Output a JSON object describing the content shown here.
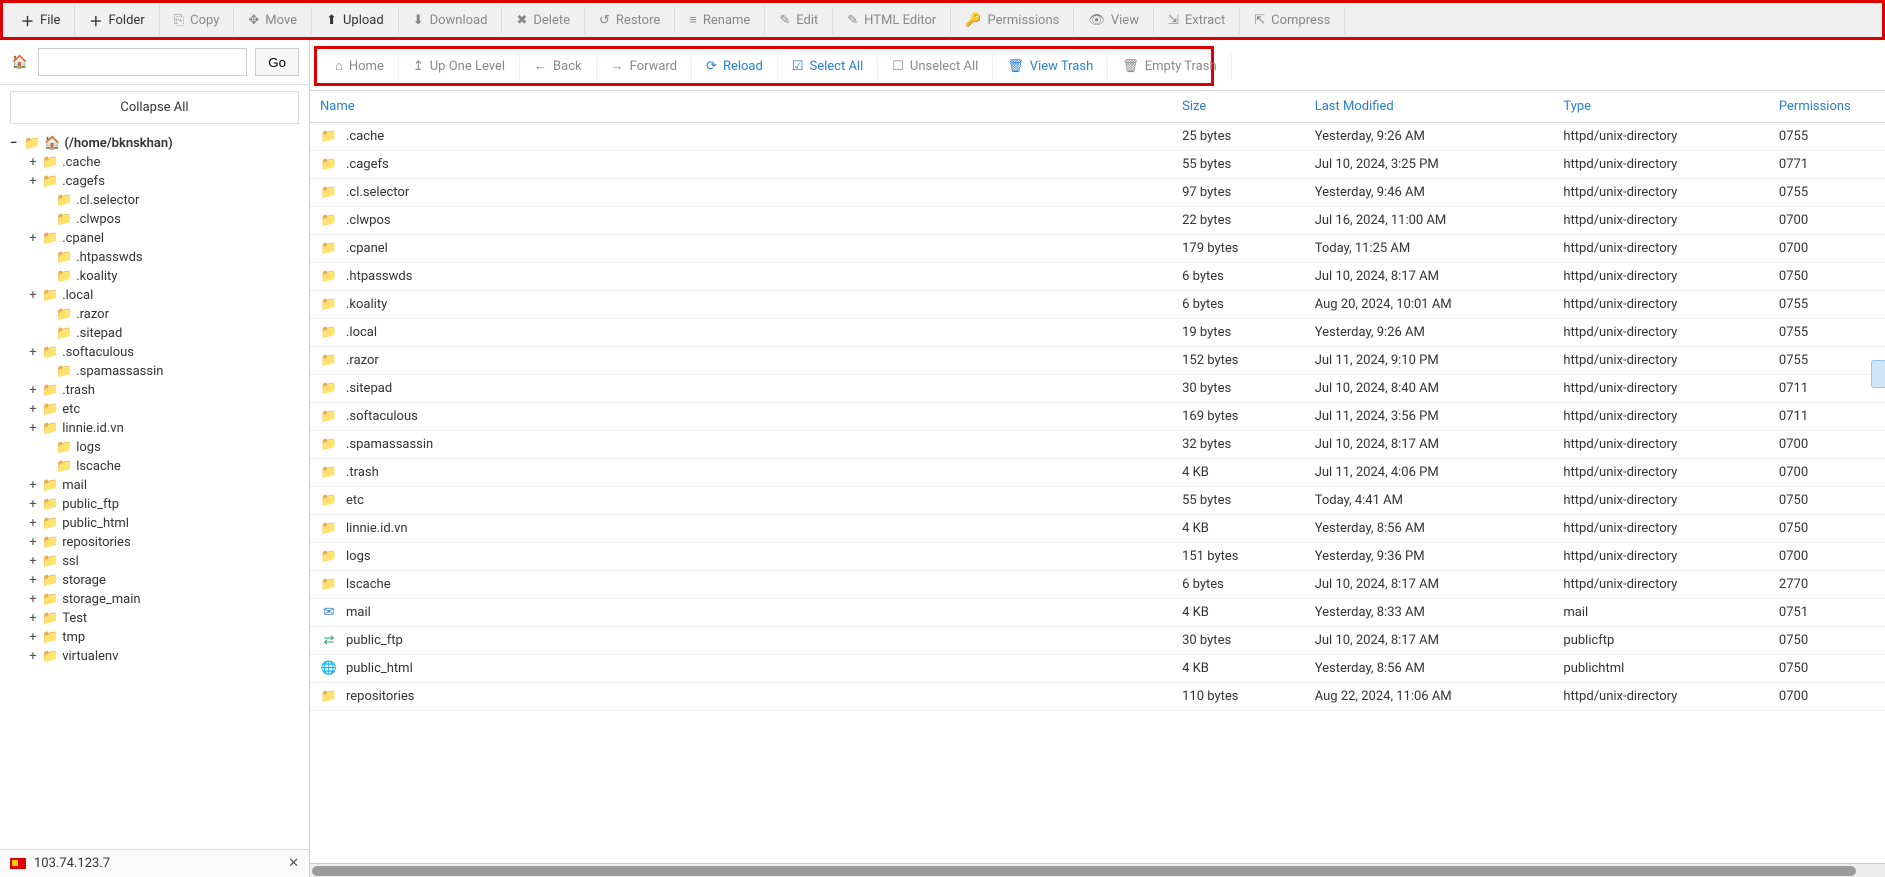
{
  "toolbarTop": [
    {
      "icon": "plus",
      "label": "File",
      "active": true
    },
    {
      "icon": "plus",
      "label": "Folder",
      "active": true
    },
    {
      "icon": "copy",
      "label": "Copy",
      "active": false
    },
    {
      "icon": "move",
      "label": "Move",
      "active": false
    },
    {
      "icon": "upload",
      "label": "Upload",
      "active": true
    },
    {
      "icon": "download",
      "label": "Download",
      "active": false
    },
    {
      "icon": "delete",
      "label": "Delete",
      "active": false
    },
    {
      "icon": "restore",
      "label": "Restore",
      "active": false
    },
    {
      "icon": "rename",
      "label": "Rename",
      "active": false
    },
    {
      "icon": "edit",
      "label": "Edit",
      "active": false
    },
    {
      "icon": "html",
      "label": "HTML Editor",
      "active": false
    },
    {
      "icon": "perm",
      "label": "Permissions",
      "active": false
    },
    {
      "icon": "view",
      "label": "View",
      "active": false
    },
    {
      "icon": "extract",
      "label": "Extract",
      "active": false
    },
    {
      "icon": "compress",
      "label": "Compress",
      "active": false
    }
  ],
  "sidebar": {
    "pathValue": "",
    "goLabel": "Go",
    "collapseLabel": "Collapse All",
    "rootLabel": "(/home/bknskhan)",
    "items": [
      {
        "name": ".cache",
        "expandable": true
      },
      {
        "name": ".cagefs",
        "expandable": true
      },
      {
        "name": ".cl.selector",
        "expandable": false,
        "indent": true
      },
      {
        "name": ".clwpos",
        "expandable": false,
        "indent": true
      },
      {
        "name": ".cpanel",
        "expandable": true
      },
      {
        "name": ".htpasswds",
        "expandable": false,
        "indent": true
      },
      {
        "name": ".koality",
        "expandable": false,
        "indent": true
      },
      {
        "name": ".local",
        "expandable": true
      },
      {
        "name": ".razor",
        "expandable": false,
        "indent": true
      },
      {
        "name": ".sitepad",
        "expandable": false,
        "indent": true
      },
      {
        "name": ".softaculous",
        "expandable": true
      },
      {
        "name": ".spamassassin",
        "expandable": false,
        "indent": true
      },
      {
        "name": ".trash",
        "expandable": true
      },
      {
        "name": "etc",
        "expandable": true
      },
      {
        "name": "linnie.id.vn",
        "expandable": true
      },
      {
        "name": "logs",
        "expandable": false,
        "indent": true
      },
      {
        "name": "lscache",
        "expandable": false,
        "indent": true
      },
      {
        "name": "mail",
        "expandable": true
      },
      {
        "name": "public_ftp",
        "expandable": true
      },
      {
        "name": "public_html",
        "expandable": true
      },
      {
        "name": "repositories",
        "expandable": true
      },
      {
        "name": "ssl",
        "expandable": true
      },
      {
        "name": "storage",
        "expandable": true
      },
      {
        "name": "storage_main",
        "expandable": true
      },
      {
        "name": "Test",
        "expandable": true
      },
      {
        "name": "tmp",
        "expandable": true
      },
      {
        "name": "virtualenv",
        "expandable": true
      }
    ],
    "footerIp": "103.74.123.7"
  },
  "toolbar2": [
    {
      "icon": "home",
      "label": "Home",
      "blue": false
    },
    {
      "icon": "up",
      "label": "Up One Level",
      "blue": false
    },
    {
      "icon": "back",
      "label": "Back",
      "blue": false
    },
    {
      "icon": "forward",
      "label": "Forward",
      "blue": false
    },
    {
      "icon": "reload",
      "label": "Reload",
      "blue": true
    },
    {
      "icon": "check",
      "label": "Select All",
      "blue": true
    },
    {
      "icon": "uncheck",
      "label": "Unselect All",
      "blue": false
    },
    {
      "icon": "trash",
      "label": "View Trash",
      "blue": true
    },
    {
      "icon": "trash",
      "label": "Empty Trash",
      "blue": false
    }
  ],
  "columns": {
    "name": "Name",
    "size": "Size",
    "modified": "Last Modified",
    "type": "Type",
    "permissions": "Permissions"
  },
  "rows": [
    {
      "icon": "folder",
      "name": ".cache",
      "size": "25 bytes",
      "modified": "Yesterday, 9:26 AM",
      "type": "httpd/unix-directory",
      "perm": "0755"
    },
    {
      "icon": "folder",
      "name": ".cagefs",
      "size": "55 bytes",
      "modified": "Jul 10, 2024, 3:25 PM",
      "type": "httpd/unix-directory",
      "perm": "0771"
    },
    {
      "icon": "folder",
      "name": ".cl.selector",
      "size": "97 bytes",
      "modified": "Yesterday, 9:46 AM",
      "type": "httpd/unix-directory",
      "perm": "0755"
    },
    {
      "icon": "folder",
      "name": ".clwpos",
      "size": "22 bytes",
      "modified": "Jul 16, 2024, 11:00 AM",
      "type": "httpd/unix-directory",
      "perm": "0700"
    },
    {
      "icon": "folder",
      "name": ".cpanel",
      "size": "179 bytes",
      "modified": "Today, 11:25 AM",
      "type": "httpd/unix-directory",
      "perm": "0700"
    },
    {
      "icon": "folder",
      "name": ".htpasswds",
      "size": "6 bytes",
      "modified": "Jul 10, 2024, 8:17 AM",
      "type": "httpd/unix-directory",
      "perm": "0750"
    },
    {
      "icon": "folder",
      "name": ".koality",
      "size": "6 bytes",
      "modified": "Aug 20, 2024, 10:01 AM",
      "type": "httpd/unix-directory",
      "perm": "0755"
    },
    {
      "icon": "folder",
      "name": ".local",
      "size": "19 bytes",
      "modified": "Yesterday, 9:26 AM",
      "type": "httpd/unix-directory",
      "perm": "0755"
    },
    {
      "icon": "folder",
      "name": ".razor",
      "size": "152 bytes",
      "modified": "Jul 11, 2024, 9:10 PM",
      "type": "httpd/unix-directory",
      "perm": "0755"
    },
    {
      "icon": "folder",
      "name": ".sitepad",
      "size": "30 bytes",
      "modified": "Jul 10, 2024, 8:40 AM",
      "type": "httpd/unix-directory",
      "perm": "0711"
    },
    {
      "icon": "folder",
      "name": ".softaculous",
      "size": "169 bytes",
      "modified": "Jul 11, 2024, 3:56 PM",
      "type": "httpd/unix-directory",
      "perm": "0711"
    },
    {
      "icon": "folder",
      "name": ".spamassassin",
      "size": "32 bytes",
      "modified": "Jul 10, 2024, 8:17 AM",
      "type": "httpd/unix-directory",
      "perm": "0700"
    },
    {
      "icon": "folder",
      "name": ".trash",
      "size": "4 KB",
      "modified": "Jul 11, 2024, 4:06 PM",
      "type": "httpd/unix-directory",
      "perm": "0700"
    },
    {
      "icon": "folder",
      "name": "etc",
      "size": "55 bytes",
      "modified": "Today, 4:41 AM",
      "type": "httpd/unix-directory",
      "perm": "0750"
    },
    {
      "icon": "folder",
      "name": "linnie.id.vn",
      "size": "4 KB",
      "modified": "Yesterday, 8:56 AM",
      "type": "httpd/unix-directory",
      "perm": "0750"
    },
    {
      "icon": "folder",
      "name": "logs",
      "size": "151 bytes",
      "modified": "Yesterday, 9:36 PM",
      "type": "httpd/unix-directory",
      "perm": "0700"
    },
    {
      "icon": "folder",
      "name": "lscache",
      "size": "6 bytes",
      "modified": "Jul 10, 2024, 8:17 AM",
      "type": "httpd/unix-directory",
      "perm": "2770"
    },
    {
      "icon": "mail",
      "name": "mail",
      "size": "4 KB",
      "modified": "Yesterday, 8:33 AM",
      "type": "mail",
      "perm": "0751"
    },
    {
      "icon": "link",
      "name": "public_ftp",
      "size": "30 bytes",
      "modified": "Jul 10, 2024, 8:17 AM",
      "type": "publicftp",
      "perm": "0750"
    },
    {
      "icon": "globe",
      "name": "public_html",
      "size": "4 KB",
      "modified": "Yesterday, 8:56 AM",
      "type": "publichtml",
      "perm": "0750"
    },
    {
      "icon": "folder",
      "name": "repositories",
      "size": "110 bytes",
      "modified": "Aug 22, 2024, 11:06 AM",
      "type": "httpd/unix-directory",
      "perm": "0700"
    }
  ]
}
